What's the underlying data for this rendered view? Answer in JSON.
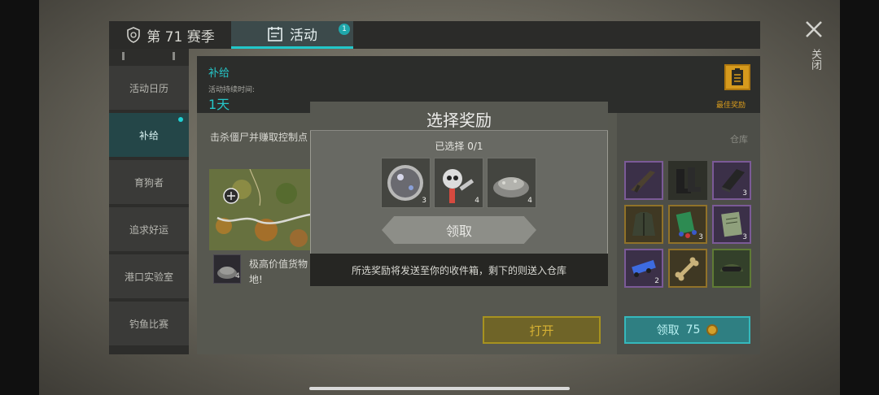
{
  "top_tabs": {
    "season_label": "第 71 赛季",
    "activity_label": "活动",
    "activity_badge": "1"
  },
  "sidebar": {
    "items": [
      {
        "label": "活动日历"
      },
      {
        "label": "补给"
      },
      {
        "label": "育狗者"
      },
      {
        "label": "追求好运"
      },
      {
        "label": "港口实验室"
      },
      {
        "label": "钓鱼比赛"
      }
    ]
  },
  "panel": {
    "title": "补给",
    "duration_label": "活动持续时间:",
    "duration_value": "1天",
    "best_reward_label": "最佳奖励",
    "description": "击杀僵尸并赚取控制点",
    "loot_line1": "极高价值货物",
    "loot_line2": "地!",
    "loot_item_count": "4",
    "open_button": "打开"
  },
  "warehouse": {
    "label": "仓库",
    "slots": [
      {
        "icon": "rifle-icon",
        "count": ""
      },
      {
        "icon": "boots-icon",
        "count": ""
      },
      {
        "icon": "fabric-icon",
        "count": "3"
      },
      {
        "icon": "jacket-icon",
        "count": ""
      },
      {
        "icon": "book-icon",
        "count": "3"
      },
      {
        "icon": "notebook-icon",
        "count": "3"
      },
      {
        "icon": "toy-car-icon",
        "count": "2"
      },
      {
        "icon": "bone-icon",
        "count": ""
      },
      {
        "icon": "goggles-cap-icon",
        "count": ""
      }
    ],
    "claim_label": "领取",
    "claim_cost": "75",
    "colors": {
      "purple": "#7b5a97",
      "gold": "#917229",
      "green": "#5f7b35",
      "teal": "#35b8bc"
    }
  },
  "modal": {
    "title": "选择奖励",
    "selected_text": "已选择 0/1",
    "rewards": [
      {
        "icon": "lens-icon",
        "count": "3"
      },
      {
        "icon": "skull-mechanism-icon",
        "count": "4"
      },
      {
        "icon": "metal-scrap-icon",
        "count": "4"
      }
    ],
    "button_label": "领取",
    "note": "所选奖励将发送至你的收件箱，剩下的则送入仓库"
  },
  "close": {
    "label": "关闭"
  }
}
